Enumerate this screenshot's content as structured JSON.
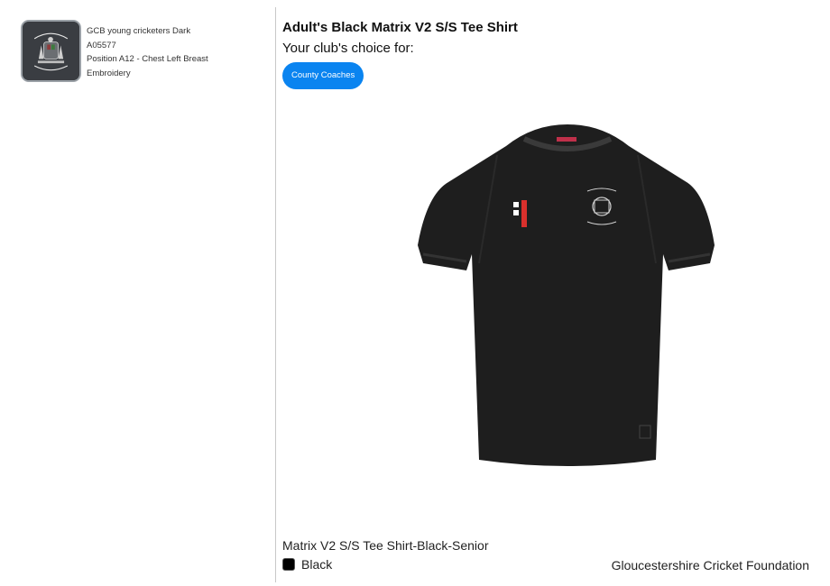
{
  "logo": {
    "icon": "club-crest-icon",
    "name": "GCB young cricketers Dark",
    "code": "A05577",
    "position": "Position A12 - Chest Left Breast",
    "method": "Embroidery"
  },
  "product": {
    "title": "Adult's Black Matrix V2 S/S Tee Shirt",
    "choice_label": "Your club's choice for:",
    "club_button": "County Coaches",
    "image_icon": "tee-shirt-icon",
    "variant_name": "Matrix V2 S/S Tee Shirt-Black-Senior",
    "colour": {
      "name": "Black",
      "hex": "#000000"
    }
  },
  "footer": {
    "organisation": "Gloucestershire Cricket Foundation"
  },
  "colors": {
    "accent": "#0a84f0",
    "divider": "#c8c8c8",
    "shirt": "#1e1e1e"
  }
}
